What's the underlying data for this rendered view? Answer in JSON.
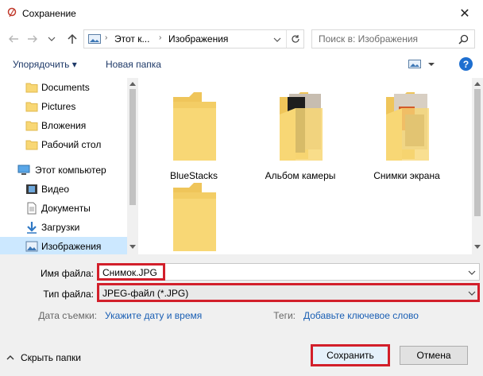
{
  "window": {
    "title": "Сохранение",
    "close_symbol": "✕"
  },
  "nav": {
    "address_segments": [
      "Этот к...",
      "Изображения"
    ],
    "search_placeholder": "Поиск в: Изображения"
  },
  "toolbar": {
    "organize_label": "Упорядочить ▾",
    "new_folder_label": "Новая папка",
    "help_symbol": "?"
  },
  "sidebar": {
    "items": [
      {
        "label": "Documents",
        "icon": "folder-icon"
      },
      {
        "label": "Pictures",
        "icon": "folder-icon"
      },
      {
        "label": "Вложения",
        "icon": "folder-icon"
      },
      {
        "label": "Рабочий стол",
        "icon": "folder-icon"
      },
      {
        "label": "Этот компьютер",
        "icon": "computer-icon"
      },
      {
        "label": "Видео",
        "icon": "video-icon"
      },
      {
        "label": "Документы",
        "icon": "documents-icon"
      },
      {
        "label": "Загрузки",
        "icon": "download-icon"
      },
      {
        "label": "Изображения",
        "icon": "pictures-icon",
        "selected": true
      }
    ]
  },
  "folders": [
    {
      "name": "BlueStacks"
    },
    {
      "name": "Альбом камеры"
    },
    {
      "name": "Снимки экрана"
    },
    {
      "name": ""
    }
  ],
  "form": {
    "filename_label": "Имя файла:",
    "filename_value": "Снимок.JPG",
    "filetype_label": "Тип файла:",
    "filetype_value": "JPEG-файл (*.JPG)",
    "date_label": "Дата съемки:",
    "date_link": "Укажите дату и время",
    "tags_label": "Теги:",
    "tags_link": "Добавьте ключевое слово"
  },
  "footer": {
    "hide_folders_label": "Скрыть папки",
    "save_label": "Сохранить",
    "cancel_label": "Отмена"
  },
  "colors": {
    "highlight": "#d21f2b",
    "link": "#1a5fb4",
    "folder": "#f8d775",
    "selected": "#cce8ff"
  }
}
